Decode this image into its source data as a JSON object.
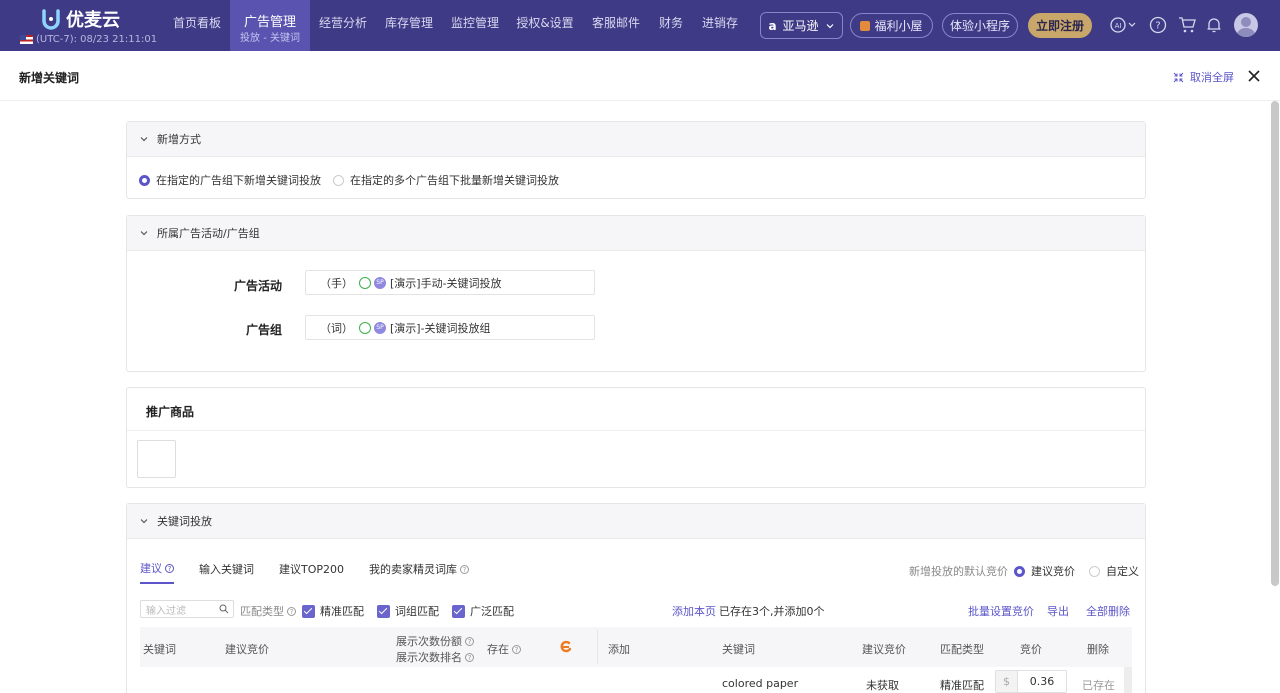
{
  "topbar": {
    "logo_text": "优麦云",
    "timezone": "(UTC-7): 08/23 21:11:01",
    "nav": [
      "首页看板",
      "经营分析",
      "库存管理",
      "监控管理",
      "授权&设置",
      "客服邮件",
      "财务",
      "进销存"
    ],
    "active_nav": {
      "label": "广告管理",
      "sub": "投放 - 关键词"
    },
    "marketplace": "亚马逊",
    "welfare": "福利小屋",
    "miniapp": "体验小程序",
    "register": "立即注册"
  },
  "drawer": {
    "title": "新增关键词",
    "fullscreen_label": "取消全屏"
  },
  "method": {
    "title": "新增方式",
    "option1": "在指定的广告组下新增关键词投放",
    "option2": "在指定的多个广告组下批量新增关键词投放"
  },
  "campaign": {
    "title": "所属广告活动/广告组",
    "campaign_label": "广告活动",
    "campaign_prefix": "（手）",
    "campaign_value": "[演示]手动-关键词投放",
    "group_label": "广告组",
    "group_prefix": "（词）",
    "group_value": "[演示]-关键词投放组",
    "sp_badge": "SP"
  },
  "product": {
    "title": "推广商品"
  },
  "keywords": {
    "title": "关键词投放",
    "tabs": [
      "建议",
      "输入关键词",
      "建议TOP200",
      "我的卖家精灵词库"
    ],
    "default_bid_label": "新增投放的默认竞价",
    "bid_option1": "建议竞价",
    "bid_option2": "自定义",
    "filter_placeholder": "输入过滤",
    "match_type_label": "匹配类型",
    "match_exact": "精准匹配",
    "match_phrase": "词组匹配",
    "match_broad": "广泛匹配",
    "add_page": "添加本页",
    "exist_summary": "已存在3个,并添加0个",
    "batch_bid": "批量设置竞价",
    "export": "导出",
    "delete_all": "全部删除",
    "left_headers": {
      "keyword": "关键词",
      "suggested_bid": "建议竞价",
      "impression_share": "展示次数份额",
      "impression_rank": "展示次数排名",
      "exists": "存在",
      "add": "添加"
    },
    "right_headers": {
      "keyword": "关键词",
      "suggested_bid": "建议竞价",
      "match_type": "匹配类型",
      "bid": "竞价",
      "delete": "删除"
    },
    "rows": [
      {
        "keyword": "colored paper",
        "suggested_bid": "未获取",
        "match_type": "精准匹配",
        "currency": "$",
        "bid": "0.36",
        "status": "已存在"
      }
    ]
  }
}
